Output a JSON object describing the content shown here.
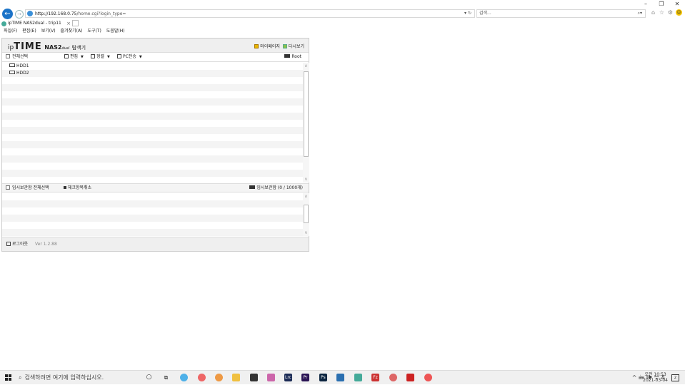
{
  "window": {
    "minimize": "–",
    "restore": "❐",
    "close": "✕"
  },
  "address": {
    "url_host": "http://192.168.0.75",
    "url_path": "/home.cgi?login_type=",
    "tools": "▾ ↻",
    "search_placeholder": "검색...",
    "search_icon": "⌕▾"
  },
  "tab": {
    "title": "ipTIME NAS2dual - trip11",
    "close": "×"
  },
  "menu": [
    "파일(F)",
    "편집(E)",
    "보기(V)",
    "즐겨찾기(A)",
    "도구(T)",
    "도움말(H)"
  ],
  "header": {
    "logo_ip": "ip",
    "logo_time": "TIME",
    "logo_model": "NAS2",
    "logo_dual": "dual",
    "logo_explorer": "탐색기",
    "mypage": "마이페이지",
    "refresh": "다시보기"
  },
  "toolbar": {
    "select_all": "전체선택",
    "edit": "편집",
    "sort": "정렬",
    "pc_transfer": "PC전송",
    "root": "Root"
  },
  "files": [
    "HDD1",
    "HDD2"
  ],
  "temp": {
    "select_all": "임시보관함 전체선택",
    "cancel_checked": "체크항목취소",
    "storage": "임시보관함 (0 / 1000개)"
  },
  "footer": {
    "logout": "로그아웃",
    "version": "Ver 1.2.88"
  },
  "taskbar": {
    "search_placeholder": "검색하려면 여기에 입력하십시오.",
    "time": "오전 10:53",
    "date": "2021-03-04",
    "notif_count": "2",
    "tray_text": "^ 🖮 🕪 ᯤ A"
  },
  "colors": {
    "accent": "#1a73c8",
    "panel_bg": "#efefef"
  }
}
